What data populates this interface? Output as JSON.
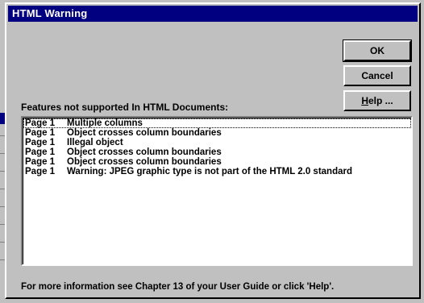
{
  "dialog": {
    "title": "HTML Warning",
    "buttons": {
      "ok": "OK",
      "cancel": "Cancel",
      "help_mnemonic": "H",
      "help_rest": "elp ..."
    },
    "list_label": "Features not supported In HTML Documents:",
    "items": [
      {
        "page": "Page 1",
        "message": "Multiple columns"
      },
      {
        "page": "Page 1",
        "message": "Object crosses column boundaries"
      },
      {
        "page": "Page 1",
        "message": "Illegal object"
      },
      {
        "page": "Page 1",
        "message": "Object crosses column boundaries"
      },
      {
        "page": "Page 1",
        "message": "Object crosses column boundaries"
      },
      {
        "page": "Page 1",
        "message": "Warning: JPEG graphic type is not part of the HTML 2.0 standard"
      }
    ],
    "footer": "For more information see Chapter 13 of your User Guide or click 'Help'."
  },
  "colors": {
    "titlebar": "#000080",
    "face": "#c0c0c0",
    "list_background": "#ffffff"
  }
}
